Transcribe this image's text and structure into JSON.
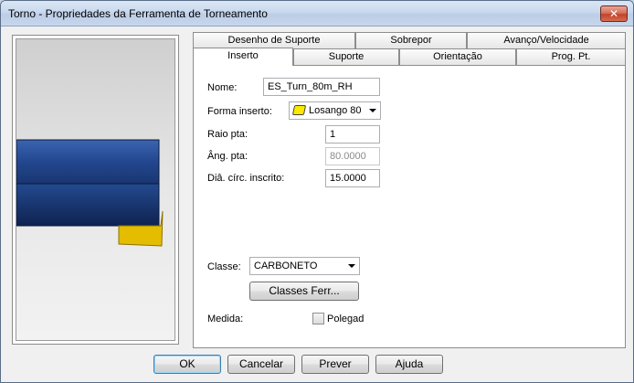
{
  "window": {
    "title": "Torno - Propriedades da Ferramenta de Torneamento",
    "close_label": "✕"
  },
  "tabs_back": [
    "Desenho de Suporte",
    "Sobrepor",
    "Avanço/Velocidade"
  ],
  "tabs_front": [
    "Inserto",
    "Suporte",
    "Orientação",
    "Prog. Pt."
  ],
  "active_tab": "Inserto",
  "form": {
    "name_label": "Nome:",
    "name_value": "ES_Turn_80m_RH",
    "shape_label": "Forma inserto:",
    "shape_value": "Losango 80",
    "shape_color": "#ffe800",
    "radius_label": "Raio pta:",
    "radius_value": "1",
    "angle_label": "Âng. pta:",
    "angle_value": "80.0000",
    "ic_label": "Diâ. círc. inscrito:",
    "ic_value": "15.0000",
    "class_label": "Classe:",
    "class_value": "CARBONETO",
    "classes_button": "Classes Ferr...",
    "measure_label": "Medida:",
    "inch_label": "Polegad"
  },
  "buttons": {
    "ok": "OK",
    "cancel": "Cancelar",
    "preview": "Prever",
    "help": "Ajuda"
  },
  "colors": {
    "tool_blue": "#1f3e78",
    "insert_yellow": "#e8c000"
  }
}
